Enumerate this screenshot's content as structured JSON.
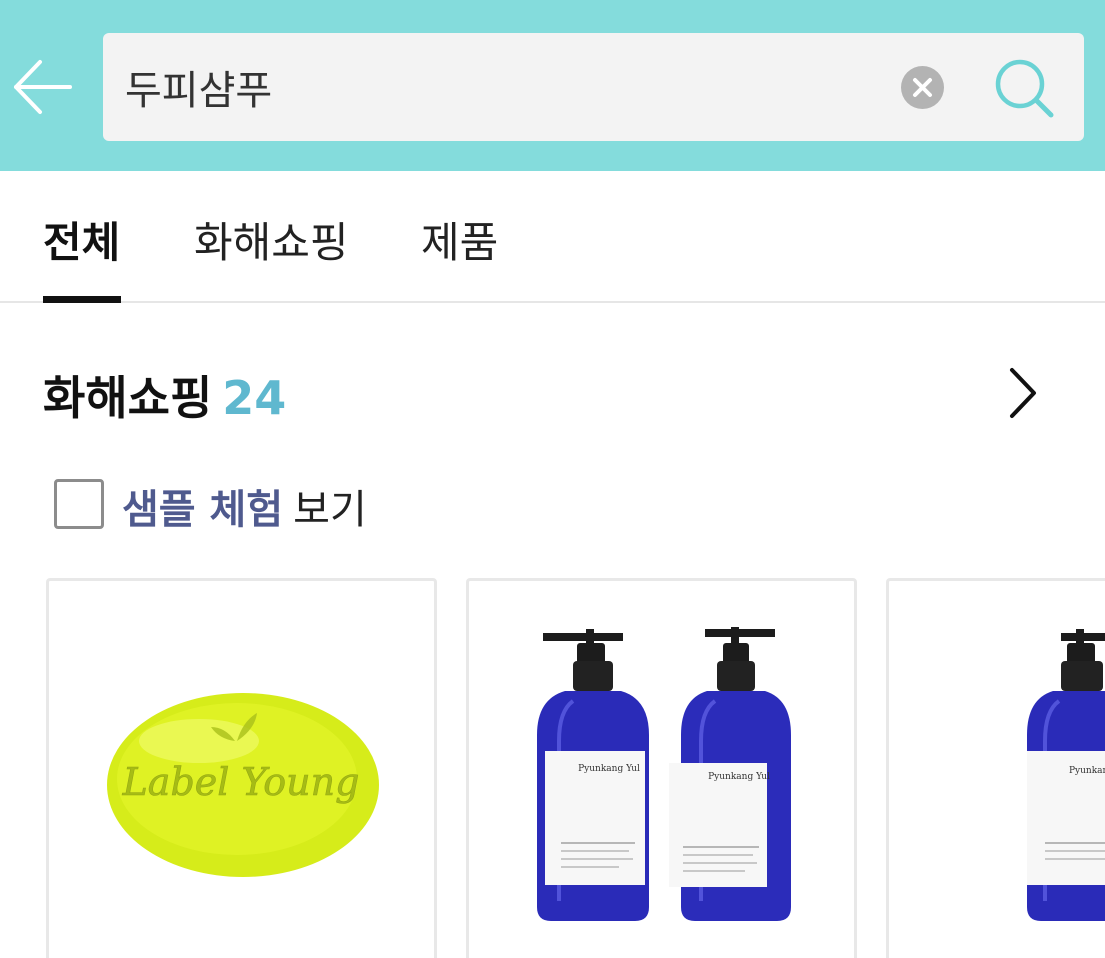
{
  "search": {
    "query": "두피샴푸",
    "placeholder": ""
  },
  "header": {
    "back_icon": "arrow-left-icon",
    "clear_icon": "clear-circle-icon",
    "search_icon": "search-icon",
    "background_color": "#84dcdc"
  },
  "tabs": [
    {
      "label": "전체",
      "active": true
    },
    {
      "label": "화해쇼핑",
      "active": false
    },
    {
      "label": "제품",
      "active": false
    }
  ],
  "section": {
    "title": "화해쇼핑",
    "count": "24",
    "count_color": "#5fb8cf",
    "more_icon": "chevron-right-icon"
  },
  "sample_filter": {
    "checked": false,
    "highlight": "샘플 체험",
    "rest": "보기",
    "highlight_color": "#4f5a8e"
  },
  "products": [
    {
      "image": "yellow-soap-bar",
      "image_text": "Label Young"
    },
    {
      "image": "shampoo-treatment-bottles",
      "image_text": "Pyunkang Yul"
    },
    {
      "image": "shampoo-bottle",
      "image_text": "Pyunkang"
    }
  ]
}
